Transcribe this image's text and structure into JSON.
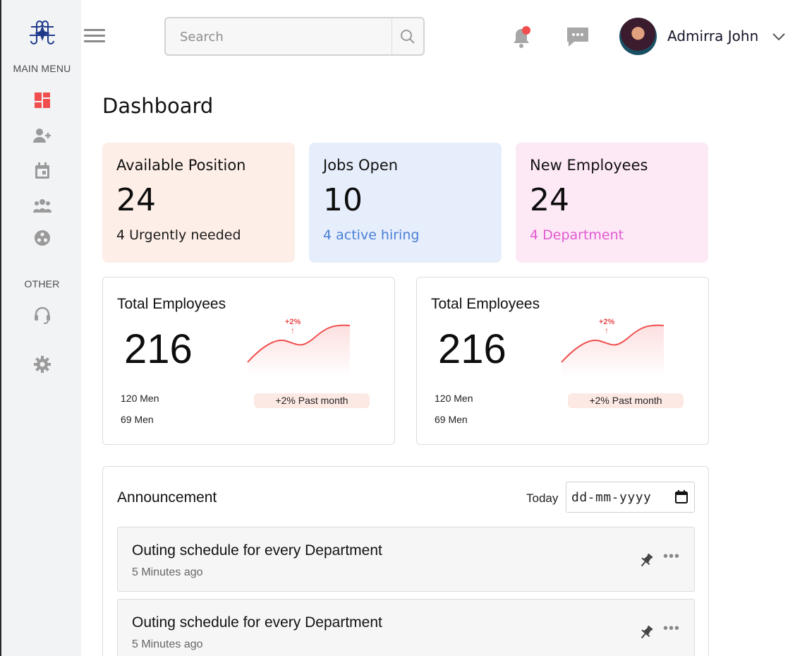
{
  "sidebar": {
    "main_menu_label": "MAIN MENU",
    "other_label": "OTHER",
    "items": [
      {
        "icon": "dashboard-icon",
        "active": true
      },
      {
        "icon": "add-user-icon"
      },
      {
        "icon": "calendar-icon"
      },
      {
        "icon": "team-icon"
      },
      {
        "icon": "departments-icon"
      }
    ],
    "other_items": [
      {
        "icon": "support-headset-icon"
      },
      {
        "icon": "gear-icon"
      }
    ],
    "accent": "#f04e4e"
  },
  "header": {
    "search_placeholder": "Search",
    "user_name": "Admirra John"
  },
  "page_title": "Dashboard",
  "stats": [
    {
      "label": "Available Position",
      "value": "24",
      "sub": "4 Urgently needed",
      "bg": "#fdeee7",
      "sub_color": "#1a1a1a"
    },
    {
      "label": "Jobs Open",
      "value": "10",
      "sub": "4 active hiring",
      "bg": "#e6eefb",
      "sub_color": "#4a7fd6"
    },
    {
      "label": "New Employees",
      "value": "24",
      "sub": "4 Department",
      "bg": "#fde8f6",
      "sub_color": "#e25ad0"
    }
  ],
  "employee_cards": [
    {
      "title": "Total Employees",
      "value": "216",
      "men_line1": "120 Men",
      "men_line2": "69 Men",
      "change": "+2%",
      "arrow": "↑",
      "pill": "+2% Past month"
    },
    {
      "title": "Total Employees",
      "value": "216",
      "men_line1": "120 Men",
      "men_line2": "69 Men",
      "change": "+2%",
      "arrow": "↑",
      "pill": "+2% Past month"
    }
  ],
  "announcement": {
    "title": "Announcement",
    "today_label": "Today",
    "date_placeholder": "dd-mm-yyyy",
    "items": [
      {
        "title": "Outing schedule for every Department",
        "time": "5 Minutes ago"
      },
      {
        "title": "Outing schedule for every Department",
        "time": "5 Minutes ago"
      }
    ]
  }
}
